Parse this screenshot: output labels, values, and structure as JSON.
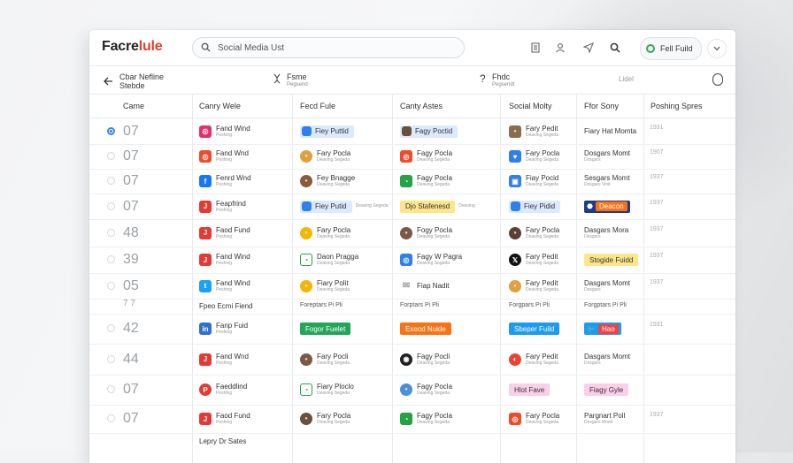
{
  "app": {
    "logo_main": "Facre",
    "logo_accent": "lule"
  },
  "search": {
    "value": "Social Media Ust"
  },
  "toolbar": {
    "fell_label": "Fell Fuild"
  },
  "subheader": {
    "left_title": "Cbar Nefline",
    "left_sub": "Stebde",
    "mid_title": "Fsme",
    "mid_sub": "Pegsend",
    "right_title": "Fhdc",
    "right_sub": "Pegsendt",
    "label_text": "Lidel"
  },
  "columns": [
    "Came",
    "Canry Wele",
    "Fecd Fule",
    "Canty Astes",
    "Social Molty",
    "Ffor Sony",
    "Poshing Spres"
  ],
  "rows": [
    {
      "selected": true,
      "num": "07",
      "date": "1931",
      "c1": {
        "icon": "instagram-icon",
        "color": "#e1306c",
        "shape": "out",
        "glyph": "◎",
        "l1": "Fand Wind",
        "l2": "Peshing"
      },
      "c2": {
        "icon": "shield-icon",
        "color": "#2f80ed",
        "chip": true,
        "chipbg": "#dbeafe",
        "l1": "Fiey Puttid"
      },
      "c3": {
        "icon": "avatar-icon",
        "color": "#6b4f3a",
        "chip": true,
        "chipbg": "#dbeafe",
        "l1": "Fagy Poctid"
      },
      "c4": {
        "icon": "avatar-icon",
        "color": "#8a6d4b",
        "l1": "Fary Pedit",
        "l2": "Deaving Segeda"
      },
      "c5": {
        "plain": true,
        "l1": "Fiary Hat Momta"
      }
    },
    {
      "selected": false,
      "num": "07",
      "date": "1907",
      "c1": {
        "icon": "instagram-icon",
        "color": "#ee4b2b",
        "glyph": "◎",
        "l1": "Fand Wnd",
        "l2": "Peshing"
      },
      "c2": {
        "icon": "avatar-icon",
        "color": "#e0a040",
        "round": true,
        "l1": "Fary Pocla",
        "l2": "Deaving Segeda"
      },
      "c3": {
        "icon": "instagram-icon",
        "color": "#ee4b2b",
        "glyph": "◎",
        "l1": "Fagy Pocla",
        "l2": "Deaving Segeda"
      },
      "c4": {
        "icon": "heart-icon",
        "color": "#2f80ed",
        "glyph": "♥",
        "l1": "Fary Pocla",
        "l2": "Deaving Segeda"
      },
      "c5": {
        "plain": true,
        "l1": "Dosgars Momt",
        "l2": "Dosgars"
      }
    },
    {
      "selected": false,
      "num": "07",
      "date": "1937",
      "c1": {
        "icon": "facebook-icon",
        "color": "#1877f2",
        "glyph": "f",
        "l1": "Fenrd Wnd",
        "l2": "Peshing"
      },
      "c2": {
        "icon": "avatar-icon",
        "color": "#8a5a3c",
        "round": true,
        "l1": "Fey Bnagge",
        "l2": "Deaving Segeda"
      },
      "c3": {
        "icon": "whatsapp-icon",
        "color": "#25a244",
        "glyph": "◔",
        "l1": "Fagy Pocla",
        "l2": "Deaving Segeda"
      },
      "c4": {
        "icon": "shield-icon",
        "color": "#2f80ed",
        "glyph": "▣",
        "l1": "Fiay Pocid",
        "l2": "Deaving Segeda"
      },
      "c5": {
        "plain": true,
        "l1": "Sesgars Momt",
        "l2": "Dosgars Vinit"
      }
    },
    {
      "selected": false,
      "num": "07",
      "date": "1937",
      "c1": {
        "icon": "pinterest-icon",
        "color": "#e53935",
        "glyph": "J",
        "l1": "Feapfrind",
        "l2": "Peshing"
      },
      "c2": {
        "icon": "shield-icon",
        "color": "#2f80ed",
        "chip": true,
        "chipbg": "#dbeafe",
        "l1": "Fiey Putid",
        "l2": "Deaving Segeda"
      },
      "c3": {
        "chip": true,
        "chipbg": "#fde68a",
        "l1": "Djo Stafenesd",
        "l2": "Deaving"
      },
      "c4": {
        "icon": "shield-icon",
        "color": "#2f80ed",
        "chip": true,
        "chipbg": "#dbeafe",
        "l1": "Fiey Pidid"
      },
      "c5": {
        "badge": true,
        "icon": "shield-icon",
        "color": "#1e3a8a",
        "chipbg": "#1e3a8a",
        "tagbg": "#f97316",
        "l1": "Deacon"
      }
    },
    {
      "selected": false,
      "num": "48",
      "date": "1937",
      "c1": {
        "icon": "pinterest-icon",
        "color": "#e53935",
        "glyph": "J",
        "l1": "Faod Fund",
        "l2": "Peshing"
      },
      "c2": {
        "icon": "avatar-icon",
        "color": "#f2b705",
        "round": true,
        "l1": "Fary Pocla",
        "l2": "Deaving Segeda"
      },
      "c3": {
        "icon": "avatar-icon",
        "color": "#7a5a44",
        "round": true,
        "l1": "Fogy Pocla",
        "l2": "Deaving Segeda"
      },
      "c4": {
        "icon": "avatar-icon",
        "color": "#5c4033",
        "round": true,
        "l1": "Fary Pocla",
        "l2": "Deaving Segeda"
      },
      "c5": {
        "plain": true,
        "l1": "Dasgars Mora",
        "l2": "Dosgars"
      }
    },
    {
      "selected": false,
      "num": "39",
      "date": "1937",
      "c1": {
        "icon": "pinterest-icon",
        "color": "#e53935",
        "glyph": "J",
        "l1": "Fand Wind",
        "l2": "Peshing"
      },
      "c2": {
        "icon": "whatsapp-icon",
        "color": "#25a244",
        "out": true,
        "glyph": "◔",
        "l1": "Daon Pragga",
        "l2": "Deaving Segeda"
      },
      "c3": {
        "icon": "instagram-icon",
        "color": "#2f80ed",
        "glyph": "◎",
        "l1": "Fagy W Pagra",
        "l2": "Deaving Segeda"
      },
      "c4": {
        "icon": "x-icon",
        "color": "#111111",
        "round": true,
        "glyph": "𝕏",
        "l1": "Fary Pedit",
        "l2": "Deaving Segeda"
      },
      "c5": {
        "chip": true,
        "chipbg": "#fde68a",
        "l1": "Stogide Fuidd"
      }
    },
    {
      "selected": false,
      "num": "05",
      "date": "1937",
      "c1": {
        "icon": "twitter-icon",
        "color": "#1da1f2",
        "glyph": "t",
        "l1": "Fand Wind",
        "l2": "Peshing"
      },
      "c2": {
        "icon": "avatar-icon",
        "color": "#f2b705",
        "round": true,
        "l1": "Fiary Polit",
        "l2": "Deaving Segeda"
      },
      "c3": {
        "icon": "email-icon",
        "color": "#999999",
        "plain_icon": true,
        "glyph": "✉",
        "l1": "Fiap Nadit"
      },
      "c4": {
        "icon": "avatar-icon",
        "color": "#e0a040",
        "round": true,
        "l1": "Fary Pedit",
        "l2": "Deaving Segeda"
      },
      "c5": {
        "plain": true,
        "l1": "Dasgars Momt",
        "l2": "Dosgars"
      }
    },
    {
      "section": true,
      "num": "7 7",
      "label": "Fpeo Ecmi Fiend",
      "c2": "Foreptars Pi Pli",
      "c3": "Forptars Pi Pli",
      "c4": "Forgpars Pi Pli",
      "c5": "Forgptars Pi Pli"
    },
    {
      "selected": false,
      "num": "42",
      "date": "1931",
      "c1": {
        "icon": "linkedin-icon",
        "color": "#2f6fd6",
        "glyph": "in",
        "l1": "Fanp Fuid",
        "l2": "Peshing"
      },
      "c2": {
        "chip": true,
        "chipbg": "#22a65a",
        "chipfg": "#ffffff",
        "l1": "Fogor Fuelet"
      },
      "c3": {
        "chip": true,
        "chipbg": "#f97316",
        "chipfg": "#ffffff",
        "l1": "Exeod Nuide"
      },
      "c4": {
        "chip": true,
        "chipbg": "#1d9bf0",
        "chipfg": "#ffffff",
        "l1": "Sbeper Fuild"
      },
      "c5": {
        "badge2": true,
        "icon": "twitter-icon",
        "color": "#1d9bf0",
        "chipbg": "#1d9bf0",
        "tagbg": "#ef4444",
        "l1": "Hao"
      }
    },
    {
      "selected": false,
      "num": "44",
      "date": "",
      "c1": {
        "icon": "pinterest-icon",
        "color": "#e53935",
        "glyph": "J",
        "l1": "Fand Wnd",
        "l2": "Peshing"
      },
      "c2": {
        "icon": "avatar-icon",
        "color": "#7a5a44",
        "round": true,
        "l1": "Fary Pocli",
        "l2": "Deaving Segeda"
      },
      "c3": {
        "icon": "github-icon",
        "color": "#222222",
        "round": true,
        "glyph": "◉",
        "l1": "Fagy Pocli",
        "l2": "Deaving Segeda"
      },
      "c4": {
        "icon": "chrome-icon",
        "color": "#ea4335",
        "round": true,
        "glyph": "◐",
        "l1": "Fary Pedit",
        "l2": "Deaving Segeda"
      },
      "c5": {
        "plain": true,
        "l1": "Dasgars Momt",
        "l2": "Dosgars"
      }
    },
    {
      "selected": false,
      "num": "07",
      "date": "",
      "c1": {
        "icon": "pinterest-icon",
        "color": "#e53935",
        "round": true,
        "glyph": "P",
        "l1": "Faeddlind",
        "l2": "Peshing"
      },
      "c2": {
        "icon": "whatsapp-icon",
        "color": "#25a244",
        "out": true,
        "glyph": "◔",
        "l1": "Fiary Ploclo",
        "l2": "Deaving Segeda"
      },
      "c3": {
        "icon": "avatar-icon",
        "color": "#4a90d9",
        "round": true,
        "l1": "Fagy Pocla",
        "l2": "Deaving Segeda"
      },
      "c4": {
        "chip": true,
        "chipbg": "#fbcfe8",
        "l1": "Hlot Fave"
      },
      "c5": {
        "chip": true,
        "chipbg": "#fbcfe8",
        "l1": "Fiagy Gyle"
      }
    },
    {
      "selected": false,
      "num": "07",
      "date": "1937",
      "c1": {
        "icon": "pinterest-icon",
        "color": "#e53935",
        "glyph": "J",
        "l1": "Faod Fund",
        "l2": "Peshing"
      },
      "c2": {
        "icon": "avatar-icon",
        "color": "#6b4f3a",
        "round": true,
        "l1": "Fary Pocla",
        "l2": "Deaving Segeda"
      },
      "c3": {
        "icon": "whatsapp-icon",
        "color": "#25a244",
        "glyph": "◔",
        "l1": "Fagy Pocla",
        "l2": "Deaving Segeda"
      },
      "c4": {
        "icon": "instagram-icon",
        "color": "#ee4b2b",
        "glyph": "◎",
        "l1": "Fary Pocla",
        "l2": "Deaving Segeda"
      },
      "c5": {
        "plain": true,
        "l1": "Pargnart Poll",
        "l2": "Dosgars Momt"
      }
    }
  ],
  "footer": {
    "label": "Lepry Dr Sates"
  }
}
